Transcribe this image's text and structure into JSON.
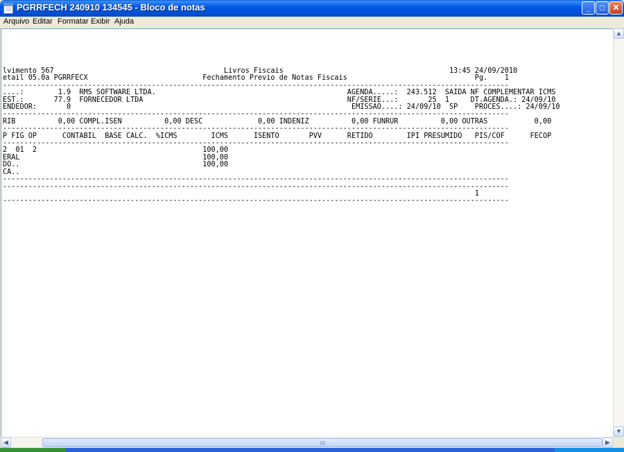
{
  "window": {
    "title": "PGRRFECH 240910 134545 - Bloco de notas"
  },
  "menu": {
    "items": [
      {
        "label": "Arquivo"
      },
      {
        "label": "Editar"
      },
      {
        "label": "Formatar"
      },
      {
        "label": "Exibir"
      },
      {
        "label": "Ajuda"
      }
    ]
  },
  "document": {
    "lines": [
      "lvimento 567                                        Livros Fiscais                                       13:45 24/09/2010",
      "etail 05.0a PGRRFECX                           Fechamento Previo de Notas Fiscais                              Pg.    1",
      "-----------------------------------------------------------------------------------------------------------------------",
      "....:        1.9  RMS SOFTWARE LTDA.                                             AGENDA.....:  243.512  SAIDA NF COMPLEMENTAR ICMS",
      "EST.:       77.9  FORNECEDOR LTDA                                                NF/SERIE...:       25  1     DT.AGENDA.: 24/09/10",
      "ENDEDOR:       0                                                                  EMISSAO....: 24/09/10  SP    PROCES....: 24/09/10",
      "-----------------------------------------------------------------------------------------------------------------------",
      "RIB          0,00 COMPL.ISEN          0,00 DESC             0,00 INDENIZ          0,00 FUNRUR          0,00 OUTRAS           0,00",
      "-----------------------------------------------------------------------------------------------------------------------",
      "P FIG OP      CONTABIL  BASE CALC.  %ICMS        ICMS      ISENTO       PVV      RETIDO        IPI PRESUMIDO   PIS/COF      FECOP",
      "-----------------------------------------------------------------------------------------------------------------------",
      "2  01  2                                       100,00",
      "ERAL                                           100,00",
      "DO..                                           100,00",
      "CA..",
      "-----------------------------------------------------------------------------------------------------------------------",
      "-----------------------------------------------------------------------------------------------------------------------",
      "                                                                                                               1",
      "-----------------------------------------------------------------------------------------------------------------------"
    ]
  },
  "icons": {
    "app": "notepad-icon",
    "minimize": "minimize-icon",
    "maximize": "maximize-icon",
    "close": "close-icon",
    "scroll_up": "arrow-up-icon",
    "scroll_down": "arrow-down-icon",
    "scroll_left": "arrow-left-icon",
    "scroll_right": "arrow-right-icon"
  },
  "colors": {
    "titlebar": "#0058e6",
    "close_button": "#c4401d",
    "menu_background": "#ece9d8",
    "editor_background": "#ffffff"
  }
}
